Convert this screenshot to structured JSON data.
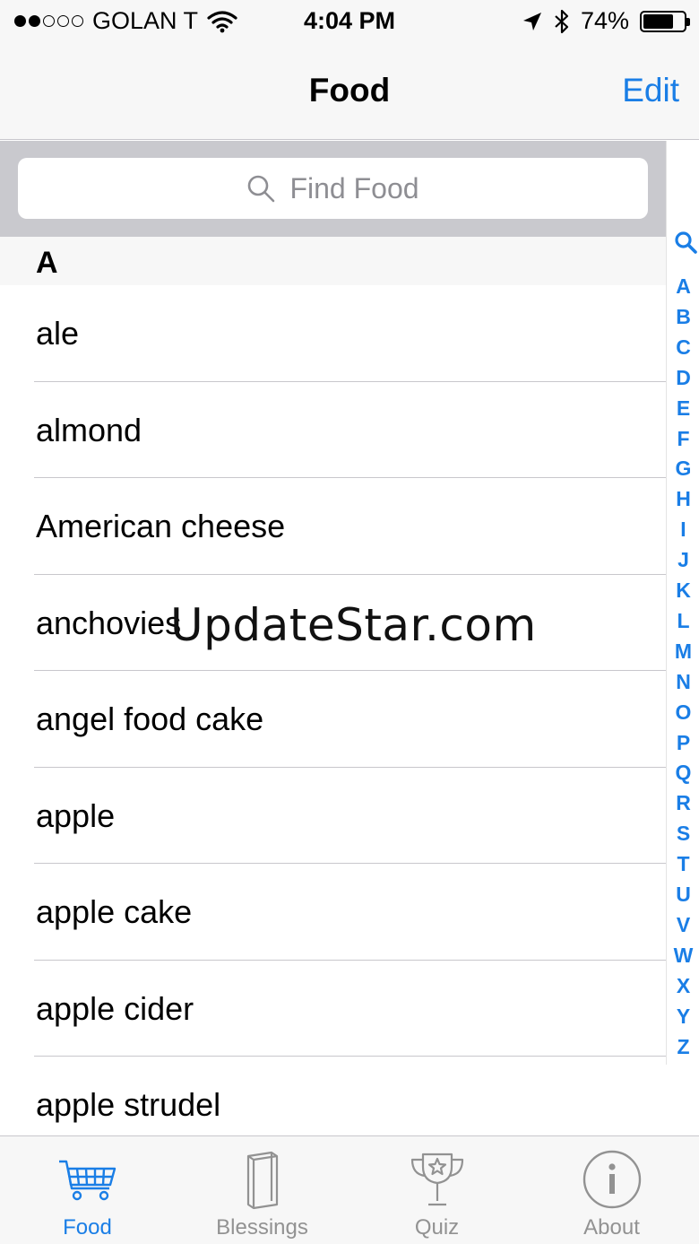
{
  "status_bar": {
    "carrier": "GOLAN T",
    "time": "4:04 PM",
    "battery_percent": "74%",
    "battery_level": 0.74,
    "signal_bars_filled": 2,
    "signal_bars_total": 5,
    "icons": [
      "wifi-icon",
      "location-icon",
      "bluetooth-icon",
      "battery-icon"
    ]
  },
  "nav": {
    "title": "Food",
    "edit_label": "Edit"
  },
  "search": {
    "placeholder": "Find Food"
  },
  "list": {
    "section": "A",
    "items": [
      "ale",
      "almond",
      "American cheese",
      "anchovies",
      "angel food cake",
      "apple",
      "apple cake",
      "apple cider",
      "apple strudel"
    ]
  },
  "index": {
    "letters": [
      "A",
      "B",
      "C",
      "D",
      "E",
      "F",
      "G",
      "H",
      "I",
      "J",
      "K",
      "L",
      "M",
      "N",
      "O",
      "P",
      "Q",
      "R",
      "S",
      "T",
      "U",
      "V",
      "W",
      "X",
      "Y",
      "Z"
    ]
  },
  "watermark": "UpdateStar.com",
  "tabs": [
    {
      "label": "Food",
      "icon": "cart-icon",
      "active": true
    },
    {
      "label": "Blessings",
      "icon": "book-icon",
      "active": false
    },
    {
      "label": "Quiz",
      "icon": "trophy-icon",
      "active": false
    },
    {
      "label": "About",
      "icon": "info-icon",
      "active": false
    }
  ],
  "colors": {
    "accent": "#1a7ee6",
    "bar_background": "#f7f7f7",
    "search_background": "#c9c9ce",
    "inactive_tab": "#929292"
  }
}
